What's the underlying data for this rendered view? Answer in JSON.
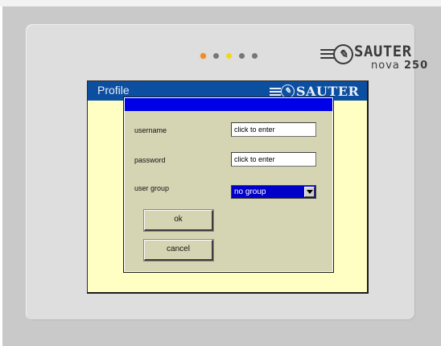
{
  "device": {
    "brand": "SAUTER",
    "model": "nova",
    "model_number": "250",
    "logo_symbol": "✎",
    "leds": [
      {
        "name": "led-1",
        "color": "#f08a2a"
      },
      {
        "name": "led-2",
        "color": "#777777"
      },
      {
        "name": "led-3",
        "color": "#f2d61e"
      },
      {
        "name": "led-4",
        "color": "#777777"
      },
      {
        "name": "led-5",
        "color": "#777777"
      }
    ]
  },
  "screen": {
    "title": "Profile",
    "brand": "SAUTER",
    "header_color": "#0c4fa0",
    "background_color": "#ffffc4"
  },
  "dialog": {
    "titlebar_color": "#0000e8",
    "fields": {
      "username": {
        "label": "username",
        "value": "click to enter"
      },
      "password": {
        "label": "password",
        "value": "click to enter"
      },
      "user_group": {
        "label": "user group",
        "value": "no group"
      }
    },
    "buttons": {
      "ok": "ok",
      "cancel": "cancel"
    }
  }
}
